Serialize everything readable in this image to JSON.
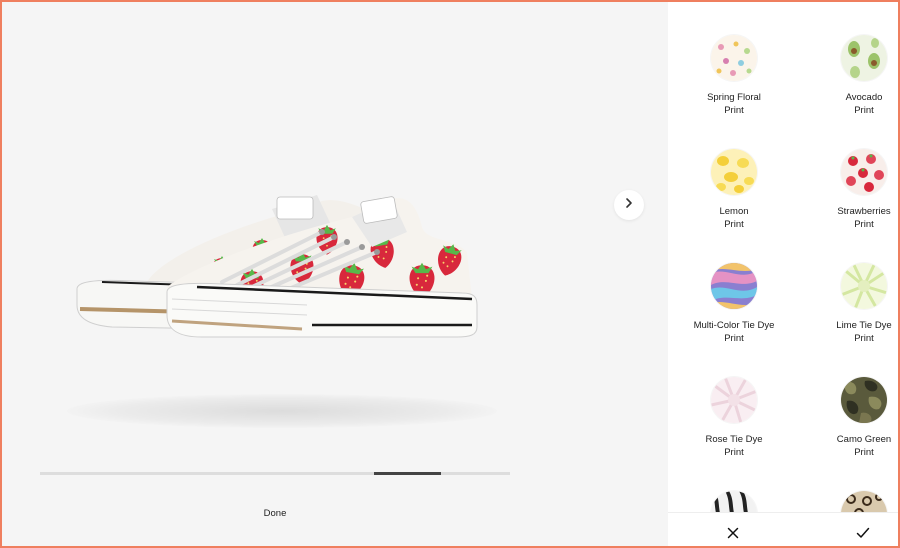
{
  "viewer": {
    "next_icon": "chevron-right-icon",
    "progress": 0.29,
    "progress_start": 0.71,
    "done_label": "Done"
  },
  "prints": {
    "items": [
      {
        "name": "Spring Floral",
        "type": "Print"
      },
      {
        "name": "Avocado",
        "type": "Print"
      },
      {
        "name": "Lemon",
        "type": "Print"
      },
      {
        "name": "Strawberries",
        "type": "Print"
      },
      {
        "name": "Multi-Color Tie Dye",
        "type": "Print"
      },
      {
        "name": "Lime Tie Dye",
        "type": "Print"
      },
      {
        "name": "Rose Tie Dye",
        "type": "Print"
      },
      {
        "name": "Camo Green",
        "type": "Print"
      },
      {
        "name": "",
        "type": ""
      },
      {
        "name": "",
        "type": ""
      }
    ]
  },
  "actions": {
    "cancel_icon": "close-icon",
    "confirm_icon": "checkmark-icon"
  },
  "colors": {
    "border": "#ef7f5f",
    "viewer_bg": "#f5f5f5",
    "strawberry_red": "#d8283c",
    "leaf_green": "#57b84a"
  }
}
